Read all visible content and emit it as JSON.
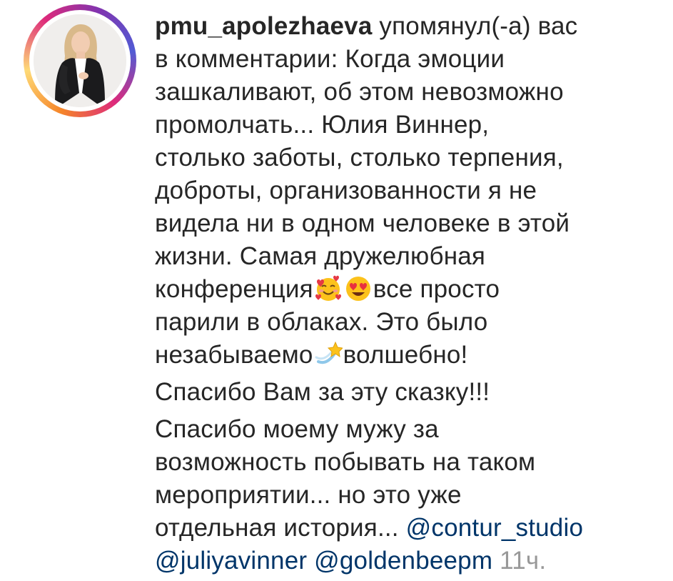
{
  "notification": {
    "username": "pmu_apolezhaeva",
    "action_text": " упомянул(-а) вас",
    "comment_lines": [
      "в комментарии: Когда эмоции",
      "зашкаливают, об этом невозможно",
      "промолчать... Юлия Виннер,",
      "столько заботы, столько терпения,",
      "доброты, организованности я не",
      "видела ни в одном человеке в этой",
      "жизни. Самая дружелюбная"
    ],
    "line_9_start": "конференция",
    "line_9_end": "все просто",
    "line_10": "парили в облаках. Это было",
    "line_11_start": "незабываемо",
    "line_11_end": "волшебно!",
    "paragraph_2": "Спасибо Вам за эту сказку!!!",
    "paragraph_3_lines": [
      "Спасибо моему мужу за",
      "возможность побывать на таком",
      "мероприятии... но это уже"
    ],
    "line_last_text": "отдельная история... ",
    "mentions": [
      "@contur_studio",
      "@juliyavinner",
      "@goldenbeepm"
    ],
    "timestamp": "11ч.",
    "emojis": [
      "smiling-face-with-hearts",
      "heart-eyes",
      "dizzy-star"
    ],
    "colors": {
      "text": "#262626",
      "mention": "#003569",
      "timestamp": "#999999",
      "story_ring": [
        "#f58529",
        "#dd2a7b",
        "#8134af",
        "#515bd4"
      ]
    }
  }
}
